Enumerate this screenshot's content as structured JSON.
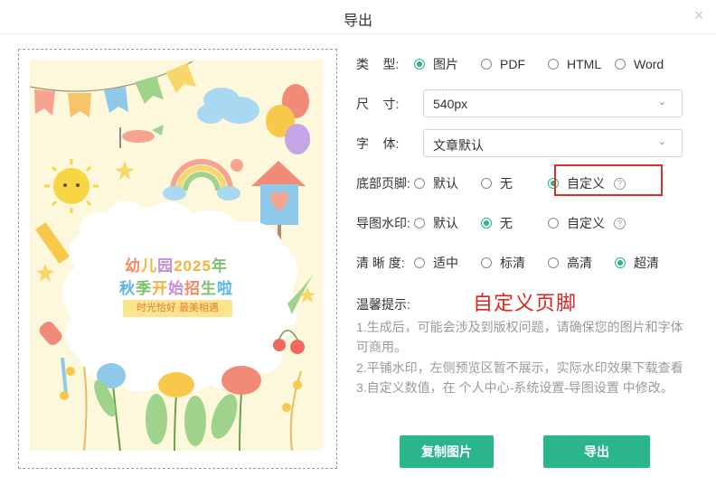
{
  "dialog": {
    "title": "导出",
    "close_icon": "×"
  },
  "poster": {
    "title_line1": [
      "幼",
      "儿",
      "园",
      "2025",
      "年"
    ],
    "title_line2": [
      "秋",
      "季",
      "开",
      "始",
      "招",
      "生",
      "啦"
    ],
    "title_colors": [
      "#f28a5e",
      "#f6b23c",
      "#7ec16b",
      "#5bb6e6",
      "#c58be0",
      "#f07a8a",
      "#f6b23c"
    ],
    "tagline": "时光恰好 最美相遇"
  },
  "form": {
    "type": {
      "label": "类    型:",
      "options": [
        {
          "label": "图片",
          "selected": true
        },
        {
          "label": "PDF",
          "selected": false
        },
        {
          "label": "HTML",
          "selected": false
        },
        {
          "label": "Word",
          "selected": false
        }
      ]
    },
    "size": {
      "label": "尺    寸:",
      "value": "540px"
    },
    "font": {
      "label": "字    体:",
      "value": "文章默认"
    },
    "footer": {
      "label": "底部页脚:",
      "options": [
        {
          "label": "默认",
          "selected": false
        },
        {
          "label": "无",
          "selected": false
        },
        {
          "label": "自定义",
          "selected": true
        }
      ]
    },
    "watermark": {
      "label": "导图水印:",
      "options": [
        {
          "label": "默认",
          "selected": false
        },
        {
          "label": "无",
          "selected": true
        },
        {
          "label": "自定义",
          "selected": false
        }
      ]
    },
    "clarity": {
      "label": "清 晰 度:",
      "options": [
        {
          "label": "适中",
          "selected": false
        },
        {
          "label": "标清",
          "selected": false
        },
        {
          "label": "高清",
          "selected": false
        },
        {
          "label": "超清",
          "selected": true
        }
      ]
    }
  },
  "tips": {
    "label": "温馨提示:",
    "annotation": "自定义页脚",
    "lines": [
      "1.生成后，可能会涉及到版权问题，请确保您的图片和字体",
      "可商用。",
      "2.平铺水印，左侧预览区暂不展示，实际水印效果下载查看",
      "3.自定义数值，在 个人中心-系统设置-导图设置 中修改。"
    ]
  },
  "buttons": {
    "copy": "复制图片",
    "export": "导出"
  },
  "colors": {
    "accent": "#2bb58d",
    "highlight": "#d9302a"
  }
}
